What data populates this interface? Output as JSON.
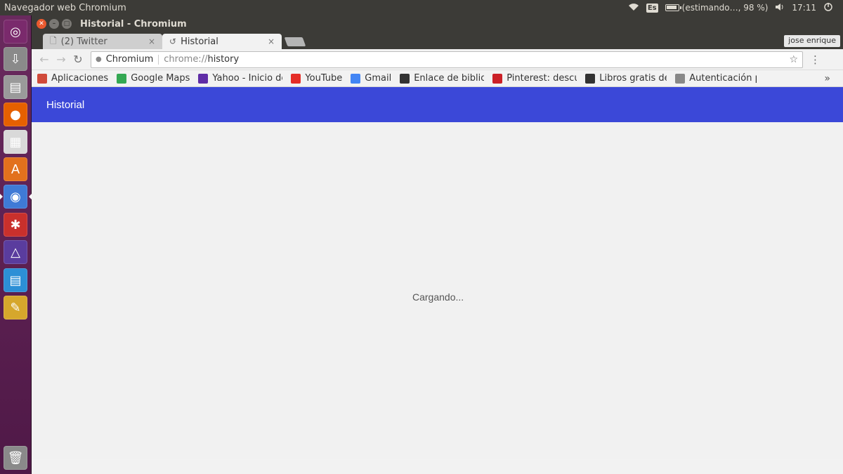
{
  "top_panel": {
    "app_title": "Navegador web Chromium",
    "keyboard": "Es",
    "battery_text": "(estimando…, 98 %)",
    "battery_level": 0.98,
    "clock": "17:11"
  },
  "launcher": {
    "items": [
      {
        "name": "ubuntu-dash-icon",
        "color": "#7a2a6c",
        "glyph": "◎"
      },
      {
        "name": "downloads-icon",
        "color": "#8a8a8a",
        "glyph": "⇩"
      },
      {
        "name": "files-icon",
        "color": "#9a9a9a",
        "glyph": "▤"
      },
      {
        "name": "firefox-icon",
        "color": "#e66000",
        "glyph": "●"
      },
      {
        "name": "impress-icon",
        "color": "#d9d9d9",
        "glyph": "▦"
      },
      {
        "name": "software-center-icon",
        "color": "#e2711d",
        "glyph": "A"
      },
      {
        "name": "chromium-icon",
        "color": "#3f7ad6",
        "glyph": "◉"
      },
      {
        "name": "settings-icon",
        "color": "#c9302c",
        "glyph": "✱"
      },
      {
        "name": "arduino-icon",
        "color": "#5a3c9e",
        "glyph": "△"
      },
      {
        "name": "writer-icon",
        "color": "#2c8fd6",
        "glyph": "▤"
      },
      {
        "name": "cleaner-icon",
        "color": "#d6a72c",
        "glyph": "✎"
      },
      {
        "name": "trash-icon",
        "color": "#8a8a8a",
        "glyph": "🗑"
      }
    ]
  },
  "window": {
    "title": "Historial - Chromium"
  },
  "tabs": [
    {
      "label": "(2) Twitter",
      "icon": "page-icon",
      "close": "×"
    },
    {
      "label": "Historial",
      "icon": "history-icon",
      "close": "×"
    }
  ],
  "profile": "jose enrique",
  "omnibox": {
    "origin": "Chromium",
    "scheme": "chrome://",
    "path": "history"
  },
  "bookmarks": [
    {
      "label": "Aplicaciones",
      "icon": "apps-icon",
      "color": "#d04a3a"
    },
    {
      "label": "Google Maps",
      "icon": "maps-icon",
      "color": "#34a853"
    },
    {
      "label": "Yahoo - Inicio de",
      "icon": "yahoo-icon",
      "color": "#5f2da6"
    },
    {
      "label": "YouTube",
      "icon": "youtube-icon",
      "color": "#e52d27"
    },
    {
      "label": "Gmail",
      "icon": "google-icon",
      "color": "#4285f4"
    },
    {
      "label": "Enlace de bibliot",
      "icon": "book-icon",
      "color": "#333333"
    },
    {
      "label": "Pinterest: descu",
      "icon": "pinterest-icon",
      "color": "#cb2027"
    },
    {
      "label": "Libros gratis de",
      "icon": "books-icon",
      "color": "#333333"
    },
    {
      "label": "Autenticación p",
      "icon": "page-icon",
      "color": "#888888"
    }
  ],
  "page": {
    "header": "Historial",
    "loading": "Cargando..."
  },
  "colors": {
    "header_bg": "#3b48d8",
    "panel_bg": "#3c3b37"
  }
}
